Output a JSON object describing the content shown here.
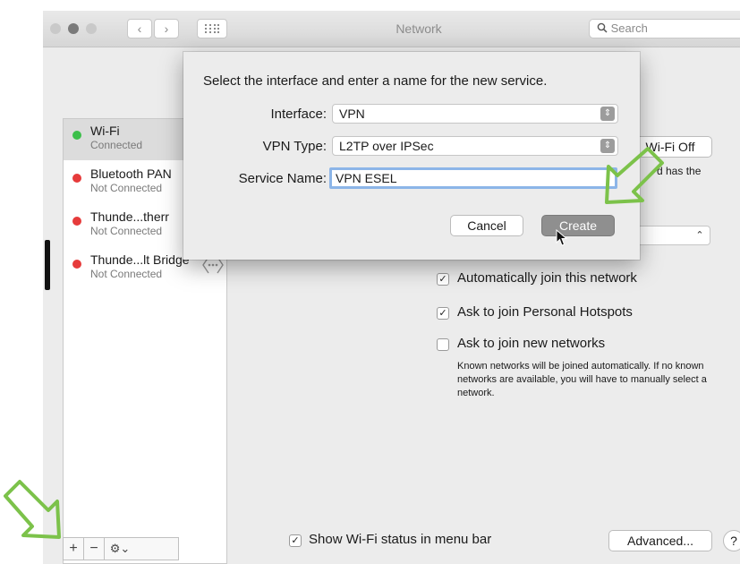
{
  "window": {
    "title": "Network",
    "search_placeholder": "Search",
    "nav_back": "‹",
    "nav_forward": "›",
    "grid_icon": "grid-icon"
  },
  "sidebar": {
    "services": [
      {
        "name": "Wi-Fi",
        "status": "Connected",
        "color": "#3cbf4a"
      },
      {
        "name": "Bluetooth PAN",
        "status": "Not Connected",
        "color": "#e63b3b"
      },
      {
        "name": "Thunde...therr",
        "status": "Not Connected",
        "color": "#e63b3b"
      },
      {
        "name": "Thunde...lt Bridge",
        "status": "Not Connected",
        "color": "#e63b3b"
      }
    ],
    "add_label": "+",
    "remove_label": "−",
    "gear_label": "⚙⌄"
  },
  "wifi_panel": {
    "turn_off_label": "Wi-Fi Off",
    "partial_text": "d has the",
    "auto_join": {
      "label": "Automatically join this network",
      "checked": true
    },
    "personal_hotspots": {
      "label": "Ask to join Personal Hotspots",
      "checked": true
    },
    "new_networks": {
      "label": "Ask to join new networks",
      "checked": false
    },
    "note": "Known networks will be joined automatically. If no known networks are available, you will have to manually select a network.",
    "show_status": {
      "label": "Show Wi-Fi status in menu bar",
      "checked": true
    },
    "advanced_label": "Advanced...",
    "help_label": "?"
  },
  "dialog": {
    "heading": "Select the interface and enter a name for the new service.",
    "interface_label": "Interface:",
    "interface_value": "VPN",
    "vpn_type_label": "VPN Type:",
    "vpn_type_value": "L2TP over IPSec",
    "service_name_label": "Service Name:",
    "service_name_value": "VPN ESEL",
    "cancel_label": "Cancel",
    "create_label": "Create"
  },
  "colors": {
    "accent_green": "#7cc24a",
    "connected": "#3cbf4a",
    "not_connected": "#e63b3b"
  }
}
